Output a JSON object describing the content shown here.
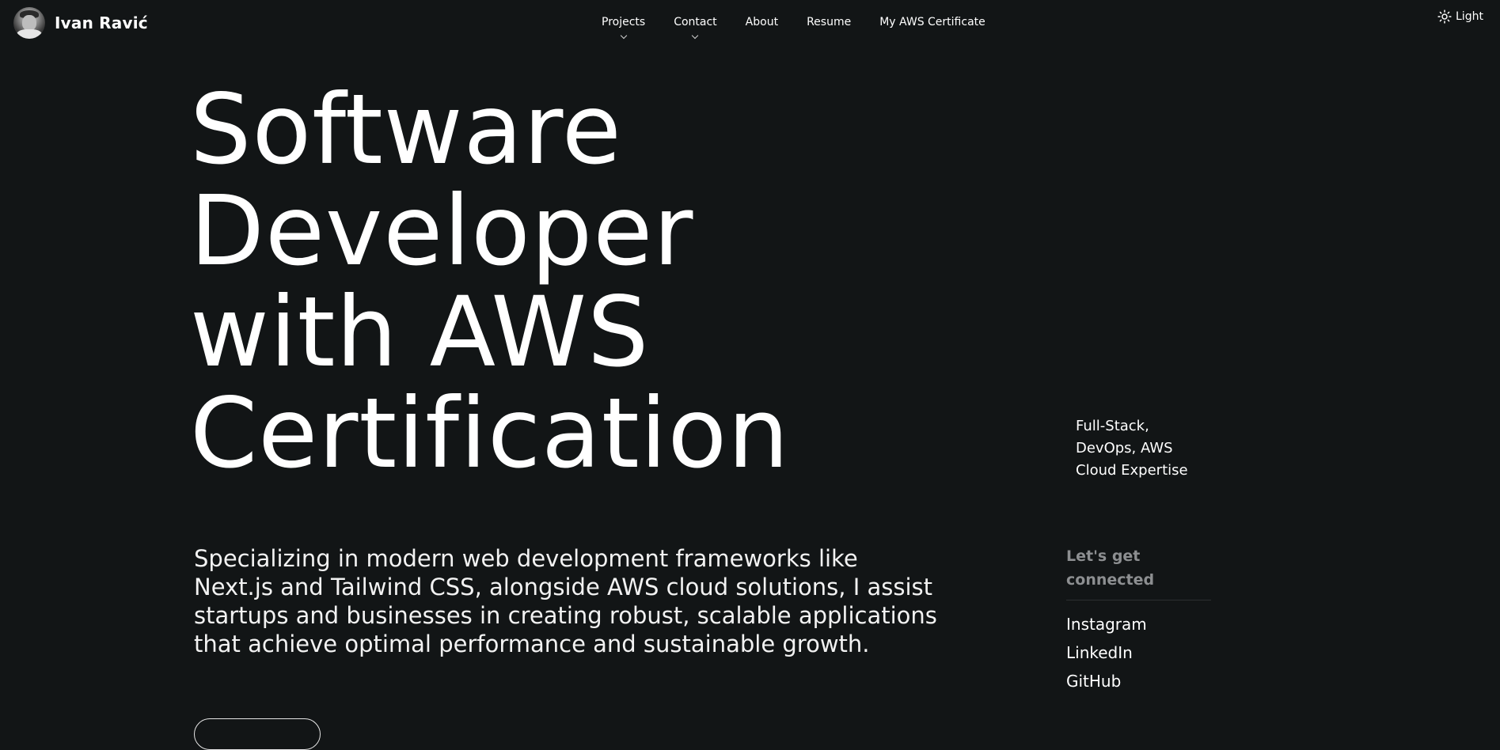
{
  "header": {
    "brand_name": "Ivan Ravić",
    "nav": [
      {
        "label": "Projects",
        "has_dropdown": true
      },
      {
        "label": "Contact",
        "has_dropdown": true
      },
      {
        "label": "About",
        "has_dropdown": false
      },
      {
        "label": "Resume",
        "has_dropdown": false
      },
      {
        "label": "My AWS Certificate",
        "has_dropdown": false
      }
    ],
    "theme_toggle": {
      "label": "Light",
      "icon": "sun-icon"
    }
  },
  "hero": {
    "title_lines": [
      "Software",
      "Developer",
      "with AWS",
      "Certification"
    ],
    "description": "Specializing in modern web development frameworks like Next.js and Tailwind CSS, alongside AWS cloud solutions, I assist startups and businesses in creating robust, scalable applications that achieve optimal performance and sustainable growth.",
    "expertise": "Full-Stack, DevOps, AWS Cloud Expertise"
  },
  "connect": {
    "title": "Let's get connected",
    "links": [
      "Instagram",
      "LinkedIn",
      "GitHub"
    ]
  },
  "colors": {
    "background": "#121516",
    "text": "#ffffff",
    "muted": "#8d8f91"
  }
}
